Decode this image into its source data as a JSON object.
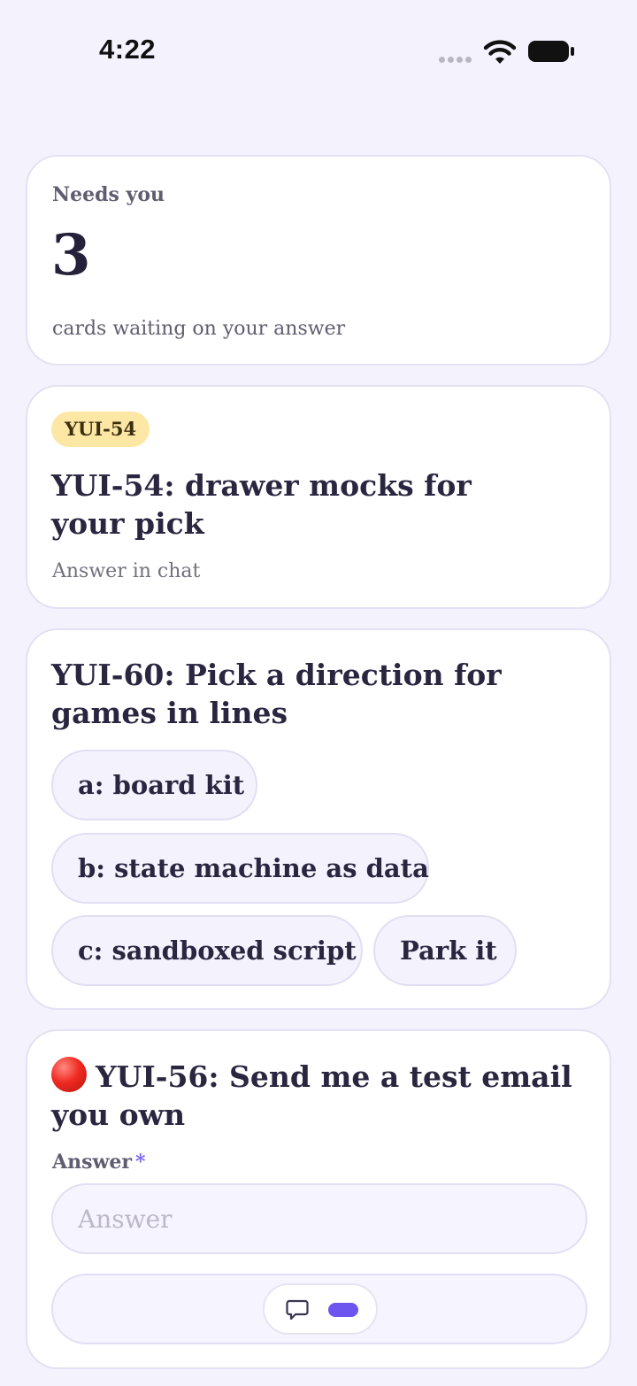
{
  "status_bar": {
    "time": "4:22"
  },
  "needs_card": {
    "label": "Needs you",
    "count": "3",
    "subtitle": "cards waiting on your answer"
  },
  "cards": {
    "yui54": {
      "badge": "YUI-54",
      "title": "YUI-54: drawer mocks for your pick",
      "subtitle": "Answer in chat"
    },
    "yui60": {
      "title": "YUI-60: Pick a direction for games in lines",
      "options": [
        "a: board kit",
        "b: state machine as data",
        "c: sandboxed script",
        "Park it"
      ]
    },
    "yui56": {
      "title": "YUI-56: Send me a test email you own",
      "status_icon": "red-circle",
      "field_label": "Answer",
      "required_mark": "*",
      "input_placeholder": "Answer",
      "input_value": ""
    }
  },
  "icons": {
    "chat": "chat-bubble-icon",
    "toggle": "mode-toggle"
  },
  "colors": {
    "background": "#f4f3fd",
    "accent": "#6d55f0",
    "badge": "#fde7a5",
    "status_red": "#ef2b22"
  }
}
